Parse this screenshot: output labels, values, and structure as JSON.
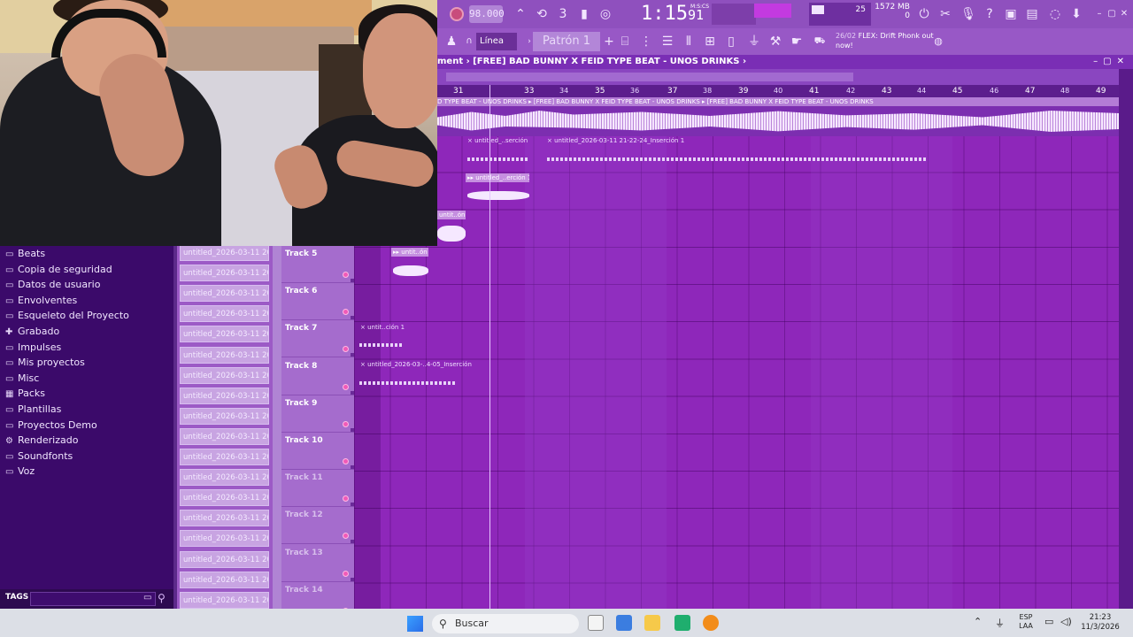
{
  "toolbar": {
    "tempo": "98.000",
    "time_main": "1:15",
    "time_sub": "91",
    "time_unit": "M:S:CS",
    "cpu_value": "25",
    "memory": "1572 MB",
    "voices": "0",
    "snap": "Línea",
    "pattern": "Patrón 1",
    "news_date": "26/02",
    "news_text": "FLEX: Drift Phonk out now!"
  },
  "playlist": {
    "title": "ment › [FREE] BAD BUNNY X FEID TYPE BEAT - UNOS DRINKS ›",
    "main_clip_label": "D TYPE BEAT - UNOS DRINKS ▸ [FREE] BAD BUNNY X FEID TYPE BEAT - UNOS DRINKS                                                                                                            ▸ [FREE] BAD BUNNY X FEID TYPE BEAT - UNOS DRINKS",
    "ruler_bars": [
      "31",
      "33",
      "34",
      "35",
      "36",
      "37",
      "38",
      "39",
      "40",
      "41",
      "42",
      "43",
      "44",
      "45",
      "46",
      "47",
      "48",
      "49"
    ],
    "clips": [
      {
        "label": "× untitled_..serción 1"
      },
      {
        "label": "× untitled_2026-03-11 21-22-24_Inserción 1"
      },
      {
        "label": "▸▸ untitled_..erción 1"
      },
      {
        "label": "untit..ón 1"
      },
      {
        "label": "▸▸ untit..ón 1"
      },
      {
        "label": "× untit..ción 1"
      },
      {
        "label": "× untitled_2026-03-..4-05_Inserción 1"
      }
    ]
  },
  "tracks": [
    {
      "name": "Track 5"
    },
    {
      "name": "Track 6"
    },
    {
      "name": "Track 7"
    },
    {
      "name": "Track 8"
    },
    {
      "name": "Track 9"
    },
    {
      "name": "Track 10"
    },
    {
      "name": "Track 11"
    },
    {
      "name": "Track 12"
    },
    {
      "name": "Track 13"
    },
    {
      "name": "Track 14"
    }
  ],
  "browser": {
    "items": [
      {
        "label": "Beats",
        "icon": "folder-icon"
      },
      {
        "label": "Copia de seguridad",
        "icon": "folder-icon"
      },
      {
        "label": "Datos de usuario",
        "icon": "folder-icon"
      },
      {
        "label": "Envolventes",
        "icon": "folder-icon"
      },
      {
        "label": "Esqueleto del Proyecto",
        "icon": "folder-icon"
      },
      {
        "label": "Grabado",
        "icon": "plus-icon"
      },
      {
        "label": "Impulses",
        "icon": "folder-icon"
      },
      {
        "label": "Mis proyectos",
        "icon": "folder-icon"
      },
      {
        "label": "Misc",
        "icon": "folder-icon"
      },
      {
        "label": "Packs",
        "icon": "pack-icon"
      },
      {
        "label": "Plantillas",
        "icon": "folder-icon"
      },
      {
        "label": "Proyectos Demo",
        "icon": "folder-icon"
      },
      {
        "label": "Renderizado",
        "icon": "render-icon"
      },
      {
        "label": "Soundfonts",
        "icon": "folder-icon"
      },
      {
        "label": "Voz",
        "icon": "folder-icon"
      }
    ],
    "tags_label": "TAGS"
  },
  "picker": {
    "items": [
      "untitled_2026-03-11 20...",
      "untitled_2026-03-11 20...",
      "untitled_2026-03-11 20...",
      "untitled_2026-03-11 20...",
      "untitled_2026-03-11 20...",
      "untitled_2026-03-11 20...",
      "untitled_2026-03-11 20...",
      "untitled_2026-03-11 20...",
      "untitled_2026-03-11 20...",
      "untitled_2026-03-11 20...",
      "untitled_2026-03-11 20...",
      "untitled_2026-03-11 20...",
      "untitled_2026-03-11 20...",
      "untitled_2026-03-11 20...",
      "untitled_2026-03-11 20...",
      "untitled_2026-03-11 20...",
      "untitled_2026-03-11 20...",
      "untitled_2026-03-11 20..."
    ]
  },
  "taskbar": {
    "search_placeholder": "Buscar",
    "lang_top": "ESP",
    "lang_bottom": "LAA",
    "time": "21:23",
    "date": "11/3/2026"
  }
}
